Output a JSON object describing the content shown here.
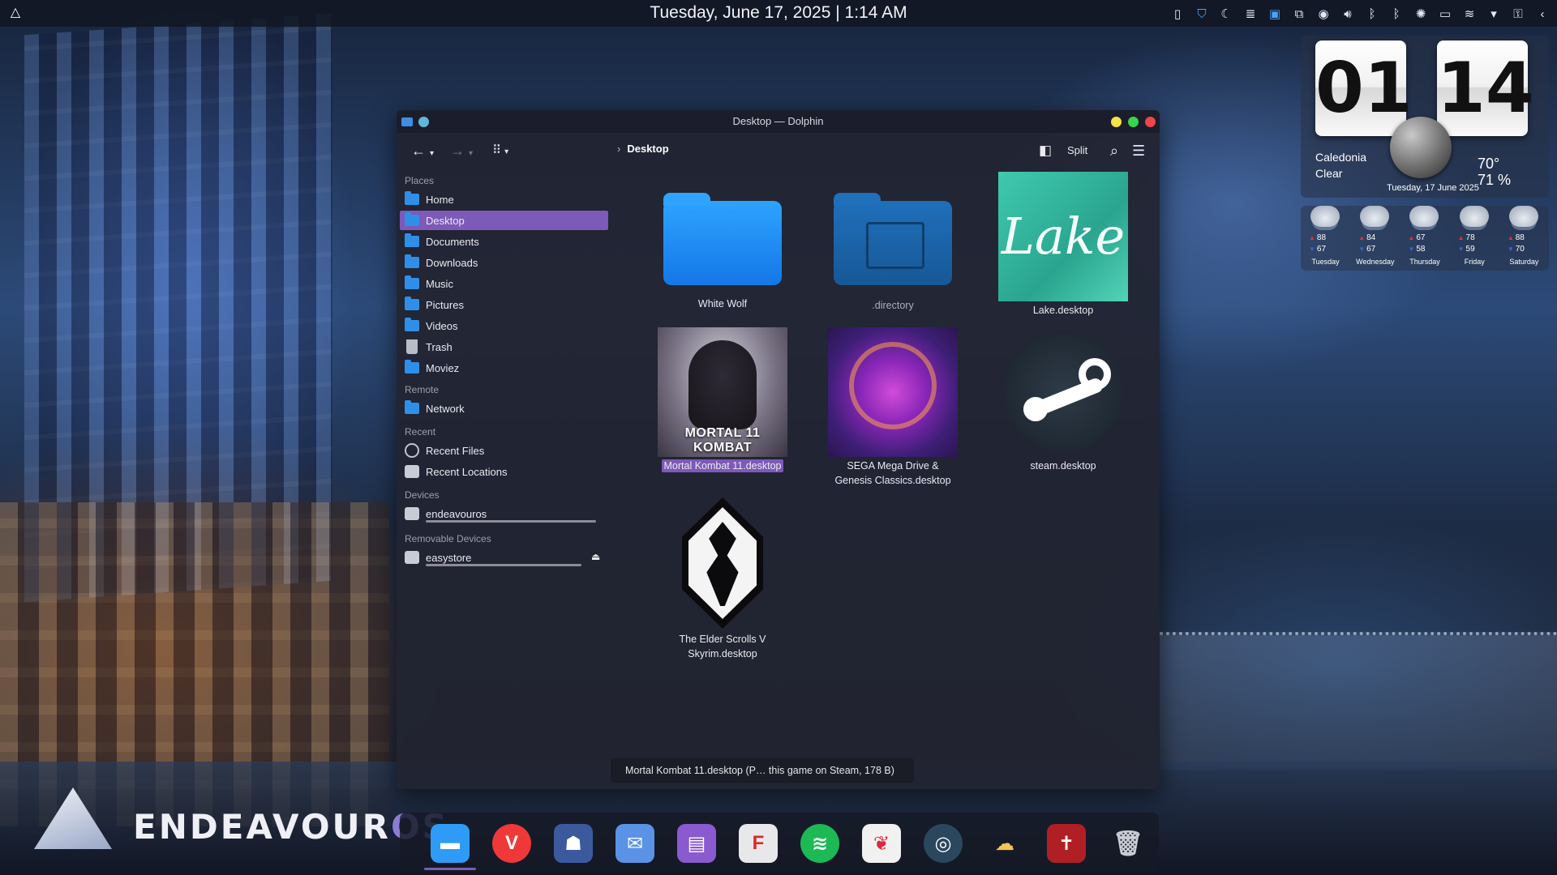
{
  "panel": {
    "datetime": "Tuesday, June 17, 2025 | 1:14 AM",
    "launcher_icon": "endeavouros-icon",
    "tray_icons": [
      "notes-icon",
      "shield-icon",
      "moon-icon",
      "clipboard-icon",
      "window-icon",
      "screen-icon",
      "media-icon",
      "volume-icon",
      "bluetooth-icon",
      "bluetooth-icon",
      "brightness-icon",
      "battery-icon",
      "wifi-icon",
      "arrow-down-icon",
      "lock-icon",
      "chevron-left-icon"
    ]
  },
  "clock_widget": {
    "hours": "01",
    "minutes": "14",
    "location": "Caledonia",
    "condition": "Clear",
    "temperature": "70°",
    "humidity": "71 %",
    "date": "Tuesday, 17 June 2025",
    "forecast": [
      {
        "day": "Tuesday",
        "high": "88",
        "low": "67"
      },
      {
        "day": "Wednesday",
        "high": "84",
        "low": "67"
      },
      {
        "day": "Thursday",
        "high": "67",
        "low": "58"
      },
      {
        "day": "Friday",
        "high": "78",
        "low": "59"
      },
      {
        "day": "Saturday",
        "high": "88",
        "low": "70"
      }
    ]
  },
  "window": {
    "title": "Desktop — Dolphin",
    "breadcrumb": "Desktop",
    "split_label": "Split",
    "sidebar": {
      "places_header": "Places",
      "places": [
        "Home",
        "Desktop",
        "Documents",
        "Downloads",
        "Music",
        "Pictures",
        "Videos",
        "Trash",
        "Moviez"
      ],
      "remote_header": "Remote",
      "remote": [
        "Network"
      ],
      "recent_header": "Recent",
      "recent": [
        "Recent Files",
        "Recent Locations"
      ],
      "devices_header": "Devices",
      "devices": [
        "endeavouros"
      ],
      "removable_header": "Removable Devices",
      "removable": [
        "easystore"
      ]
    },
    "files": [
      {
        "name": "White Wolf"
      },
      {
        "name": ".directory"
      },
      {
        "name": "Lake.desktop",
        "thumb_text": "Lake"
      },
      {
        "name": "Mortal Kombat 11.desktop",
        "thumb_text": "MORTAL 11 KOMBAT"
      },
      {
        "name": "SEGA Mega Drive & Genesis Classics.desktop"
      },
      {
        "name": "steam.desktop"
      },
      {
        "name": "The Elder Scrolls V Skyrim.desktop"
      }
    ],
    "status_text": "Mortal Kombat 11.desktop (P… this game on Steam, 178 B)"
  },
  "desktop_logo": {
    "text_main": "ENDEAVOUR",
    "text_os": "OS"
  },
  "dock": {
    "apps": [
      {
        "name": "dolphin-icon",
        "color": "#2e9cf7"
      },
      {
        "name": "vivaldi-icon",
        "color": "#ef3939",
        "glyph": "V"
      },
      {
        "name": "ghost-app-icon",
        "color": "#3b5a9e"
      },
      {
        "name": "mail-icon",
        "color": "#5a93e6"
      },
      {
        "name": "archive-icon",
        "color": "#8a5ad0"
      },
      {
        "name": "flipboard-icon",
        "color": "#e8e8ea",
        "glyph": "F"
      },
      {
        "name": "spotify-icon",
        "color": "#1db954"
      },
      {
        "name": "strawberry-icon",
        "color": "#f1f1f1"
      },
      {
        "name": "steam-icon",
        "color": "#2a475e"
      },
      {
        "name": "weather-icon",
        "color": "#e8b24a"
      },
      {
        "name": "bible-icon",
        "color": "#b01f24",
        "glyph": "✝"
      },
      {
        "name": "trash-icon",
        "color": "#c9ccd2"
      }
    ]
  }
}
